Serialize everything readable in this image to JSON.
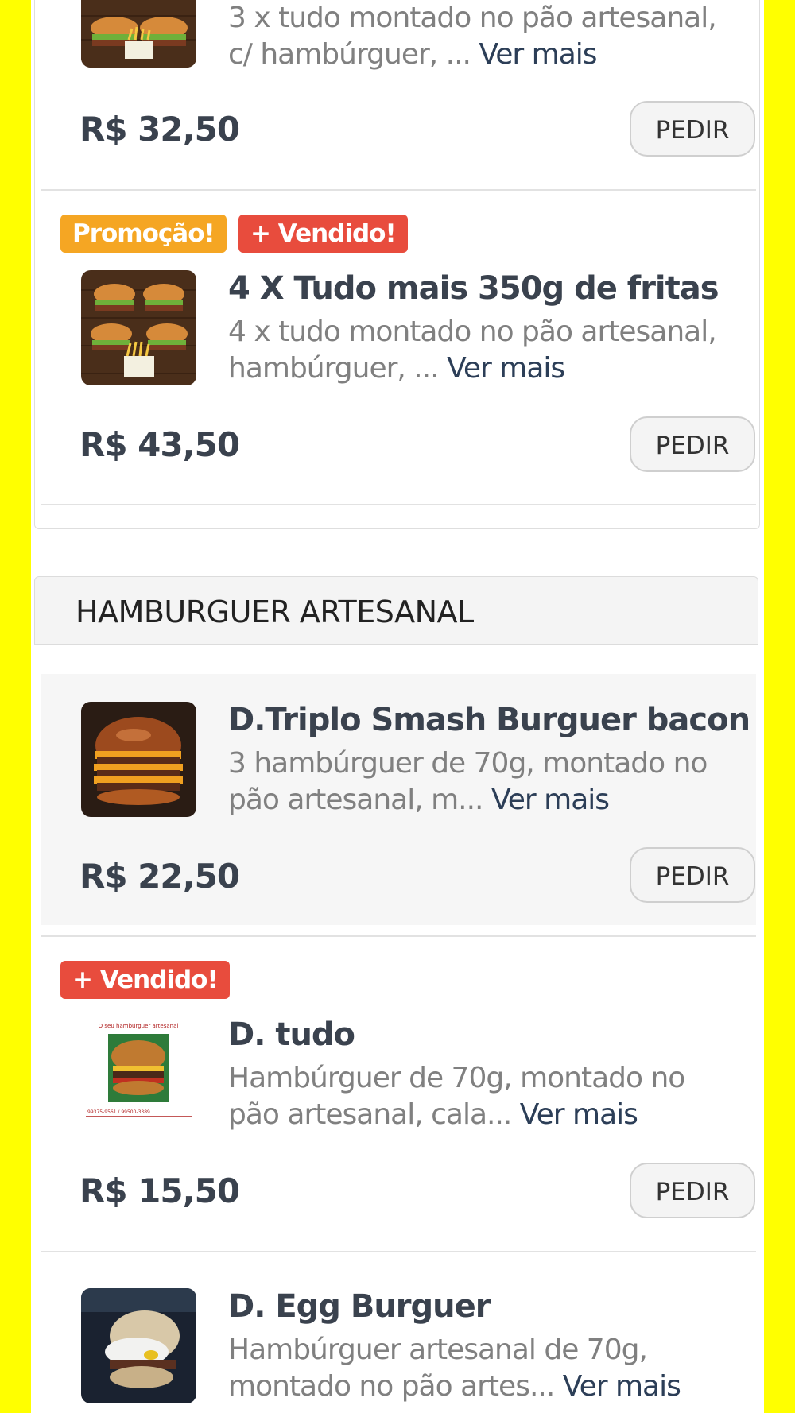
{
  "items": [
    {
      "badges": [],
      "title": "",
      "description": "3 x tudo montado no pão artesanal, c/ hambúrguer, ...",
      "more": "Ver mais",
      "price": "R$ 32,50",
      "button": "PEDIR",
      "image": "three-burgers-with-fries"
    },
    {
      "badges": [
        "Promoção!",
        "+ Vendido!"
      ],
      "title": "4 X Tudo mais 350g de fritas",
      "description": "4 x tudo montado no pão artesanal, hambúrguer, ...",
      "more": "Ver mais",
      "price": "R$ 43,50",
      "button": "PEDIR",
      "image": "four-burgers-with-fries"
    }
  ],
  "section": {
    "title": "HAMBURGUER ARTESANAL"
  },
  "section_items": [
    {
      "badges": [],
      "title": "D.Triplo Smash Burguer bacon",
      "description": "3 hambúrguer de 70g, montado no pão artesanal, m...",
      "more": "Ver mais",
      "price": "R$ 22,50",
      "button": "PEDIR",
      "image": "triple-smash-burger"
    },
    {
      "badges": [
        "+ Vendido!"
      ],
      "title": "D. tudo",
      "description": "Hambúrguer de 70g, montado no pão artesanal, cala...",
      "more": "Ver mais",
      "price": "R$ 15,50",
      "button": "PEDIR",
      "image": "burger-flyer",
      "image_text_top": "O seu hambúrguer artesanal",
      "image_text_bottom": "99375-9561 / 99500-3389"
    },
    {
      "badges": [],
      "title": "D. Egg Burguer",
      "description": "Hambúrguer artesanal de 70g, montado no pão artes...",
      "more": "Ver mais",
      "image": "egg-burger-photo"
    }
  ],
  "colors": {
    "background": "#ffff00",
    "promo_badge": "#f5a623",
    "sold_badge": "#e84c3d",
    "link": "#2c3e57"
  }
}
